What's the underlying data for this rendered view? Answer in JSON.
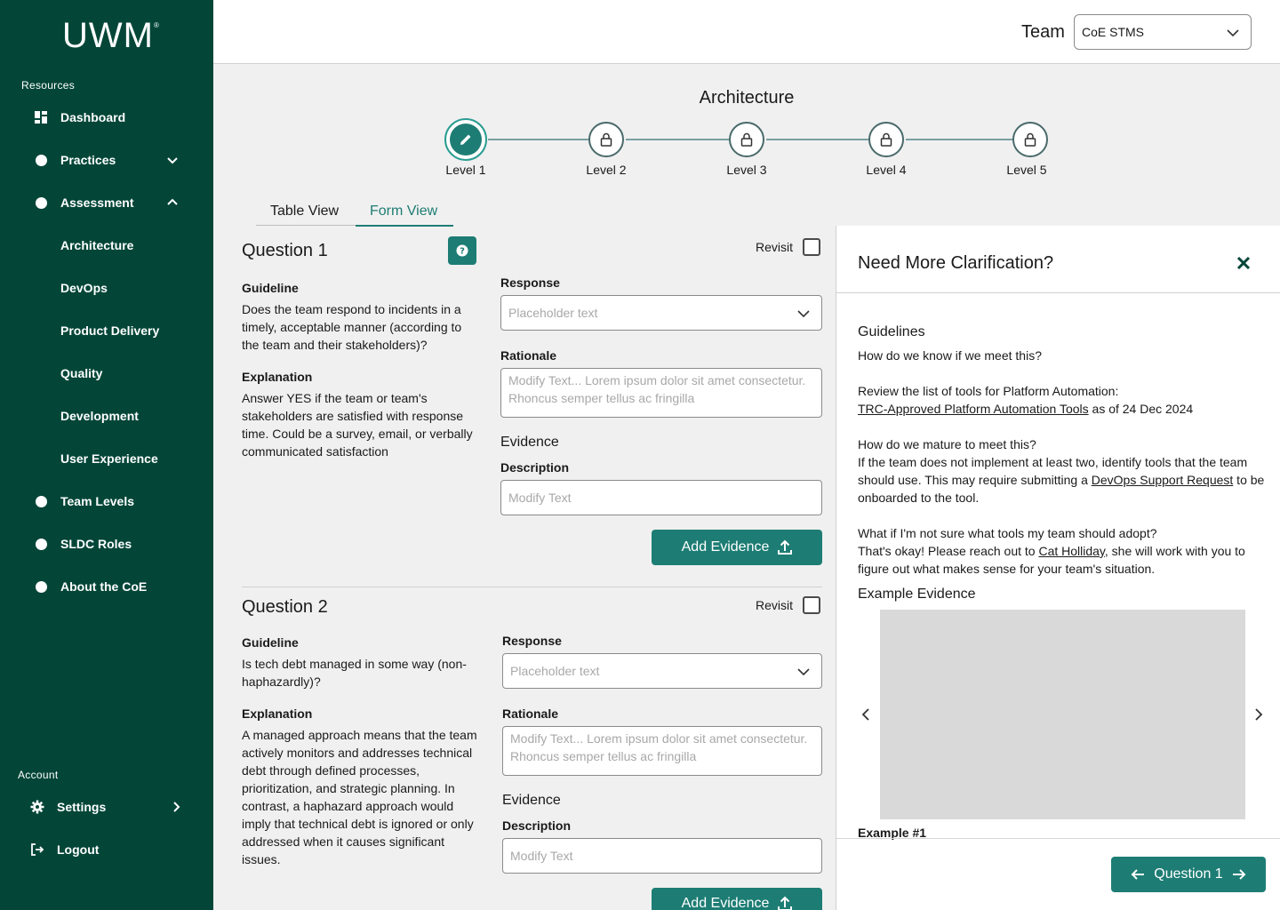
{
  "sidebar": {
    "logo": "UWM",
    "logo_mark": "®",
    "resources_label": "Resources",
    "account_label": "Account",
    "items": [
      {
        "label": "Dashboard",
        "icon": "dashboard-icon"
      },
      {
        "label": "Practices",
        "icon": "dot-icon"
      },
      {
        "label": "Assessment",
        "icon": "dot-icon"
      },
      {
        "label": "Team Levels",
        "icon": "dot-icon"
      },
      {
        "label": "SLDC Roles",
        "icon": "dot-icon"
      },
      {
        "label": "About the CoE",
        "icon": "dot-icon"
      }
    ],
    "sub_items": [
      {
        "label": "Architecture"
      },
      {
        "label": "DevOps"
      },
      {
        "label": "Product Delivery"
      },
      {
        "label": "Quality"
      },
      {
        "label": "Development"
      },
      {
        "label": "User Experience"
      }
    ],
    "account_items": [
      {
        "label": "Settings",
        "icon": "gear-icon"
      },
      {
        "label": "Logout",
        "icon": "logout-icon"
      }
    ]
  },
  "header": {
    "team_label": "Team",
    "team_value": "CoE STMS"
  },
  "page": {
    "title": "Architecture",
    "levels": [
      "Level 1",
      "Level 2",
      "Level 3",
      "Level 4",
      "Level 5"
    ],
    "tabs": [
      "Table View",
      "Form View"
    ]
  },
  "questions": [
    {
      "title": "Question 1",
      "revisit": "Revisit",
      "guideline_label": "Guideline",
      "guideline": "Does the team respond to incidents in a timely, acceptable manner (according to the team and their stakeholders)?",
      "explanation_label": "Explanation",
      "explanation": "Answer YES if the team or team's stakeholders are satisfied with response time. Could be a survey, email, or verbally communicated satisfaction",
      "response_label": "Response",
      "response_placeholder": "Placeholder text",
      "rationale_label": "Rationale",
      "rationale_placeholder": "Modify Text... Lorem ipsum dolor sit amet consectetur. Rhoncus semper tellus ac fringilla",
      "evidence_label": "Evidence",
      "description_label": "Description",
      "description_placeholder": "Modify Text",
      "add_evidence": "Add Evidence"
    },
    {
      "title": "Question 2",
      "revisit": "Revisit",
      "guideline_label": "Guideline",
      "guideline": "Is tech debt managed in some way (non-haphazardly)?",
      "explanation_label": "Explanation",
      "explanation": "A managed approach means that the team actively monitors and addresses technical debt through defined processes, prioritization, and strategic planning. In contrast, a haphazard approach would imply that technical debt is ignored or only addressed when it causes significant issues.",
      "response_label": "Response",
      "response_placeholder": "Placeholder text",
      "rationale_label": "Rationale",
      "rationale_placeholder": "Modify Text... Lorem ipsum dolor sit amet consectetur. Rhoncus semper tellus ac fringilla",
      "evidence_label": "Evidence",
      "description_label": "Description",
      "description_placeholder": "Modify Text",
      "add_evidence": "Add Evidence"
    }
  ],
  "panel": {
    "title": "Need More Clarification?",
    "guidelines_head": "Guidelines",
    "q_know": "How do we know if we meet this?",
    "review_text": "Review the list of tools for Platform Automation:",
    "review_link": "TRC-Approved Platform Automation Tools",
    "review_suffix": " as of 24 Dec 2024",
    "q_mature": "How do we mature to meet this?",
    "mature_text_1": "If the team does not implement at least two, identify tools that the team should use. This may require submitting a ",
    "mature_link": "DevOps Support Request",
    "mature_text_2": " to be onboarded to the tool.",
    "q_unsure": "What if I'm not sure what tools my team should adopt?",
    "unsure_text_1": "That's okay! Please reach out to ",
    "unsure_link": "Cat Holliday",
    "unsure_text_2": ", she will work with you to figure out what makes sense for your team's situation.",
    "example_head": "Example Evidence",
    "example_caption": "Example #1",
    "nav_button": "Question 1"
  },
  "colors": {
    "sidebar_bg": "#034638",
    "accent": "#1d7d74",
    "tab_active": "#1d7d74"
  }
}
